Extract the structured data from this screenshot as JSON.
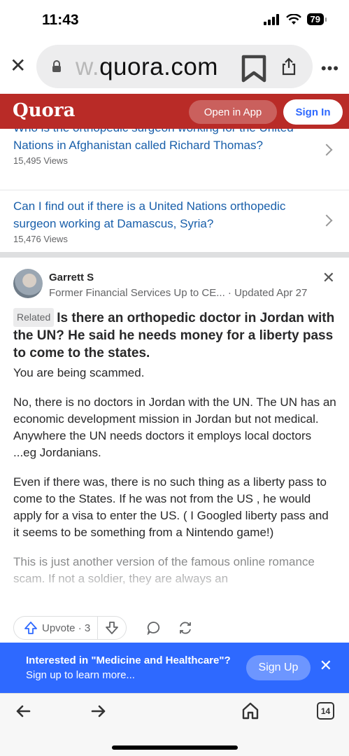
{
  "status": {
    "time": "11:43",
    "battery": "79"
  },
  "browser": {
    "url_prefix": "w.",
    "url_domain": "quora.com"
  },
  "header": {
    "logo": "Quora",
    "open_app": "Open in App",
    "sign_in": "Sign In"
  },
  "related_questions": [
    {
      "question": "Who is the orthopedic surgeon working for the United Nations in Afghanistan called Richard Thomas?",
      "views": "15,495 Views"
    },
    {
      "question": "Can I find out if there is a United Nations orthopedic surgeon working at Damascus, Syria?",
      "views": "15,476 Views"
    }
  ],
  "answer": {
    "author": "Garrett S",
    "credential": "Former Financial Services Up to CE...",
    "updated": "· Updated Apr 27",
    "related_tag": "Related",
    "question": "Is there an orthopedic doctor in Jordan with the UN? He said he needs money for a liberty pass to come to the states.",
    "paragraphs": [
      "You are being scammed.",
      "No, there is no doctors in Jordan with the UN. The UN has an economic development mission in Jordan but not medical. Anywhere the UN needs doctors it employs local doctors ...eg Jordanians.",
      "Even if there was, there is no such thing as a liberty pass to come to the States. If he was not from the US , he would apply for a visa to enter the US. ( I Googled liberty pass and it seems to be something from a Nintendo game!)",
      "This is just another version of the famous online romance scam. If not a soldier, they are always an"
    ]
  },
  "actions": {
    "upvote_label": "Upvote · 3"
  },
  "signup_banner": {
    "bold_text": "Interested in \"Medicine and Healthcare\"?",
    "text": " Sign up to learn more...",
    "button": "Sign Up"
  },
  "toolbar": {
    "tab_count": "14"
  },
  "colors": {
    "quora_red": "#b92b27",
    "link_blue": "#195faa",
    "banner_blue": "#2e69ff"
  }
}
